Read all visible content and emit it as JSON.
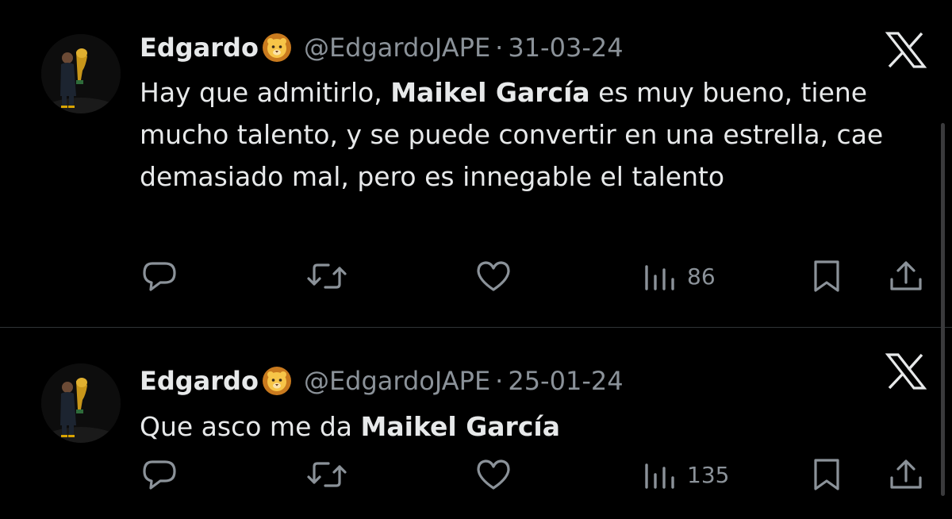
{
  "tweets": [
    {
      "author_name": "Edgardo",
      "author_emoji": "lion-face-emoji",
      "handle": "@EdgardoJAPE",
      "separator": "·",
      "date": "31-03-24",
      "text_1": "Hay que admitirlo, ",
      "text_bold": "Maikel García",
      "text_2": " es muy bueno, tiene mucho talento, y se puede convertir en una estrella, cae demasiado mal, pero es innegable el talento",
      "views": "86"
    },
    {
      "author_name": "Edgardo",
      "author_emoji": "lion-face-emoji",
      "handle": "@EdgardoJAPE",
      "separator": "·",
      "date": "25-01-24",
      "text_1": "Que asco me da ",
      "text_bold": "Maikel García",
      "text_2": "",
      "views": "135"
    }
  ],
  "icons": {
    "reply": "reply-icon",
    "retweet": "retweet-icon",
    "like": "heart-icon",
    "views": "views-icon",
    "bookmark": "bookmark-icon",
    "share": "share-icon",
    "brand": "x-logo-icon"
  },
  "colors": {
    "background": "#000000",
    "text_primary": "#e7e9ea",
    "text_secondary": "#8b9299",
    "divider": "#2f3336"
  }
}
